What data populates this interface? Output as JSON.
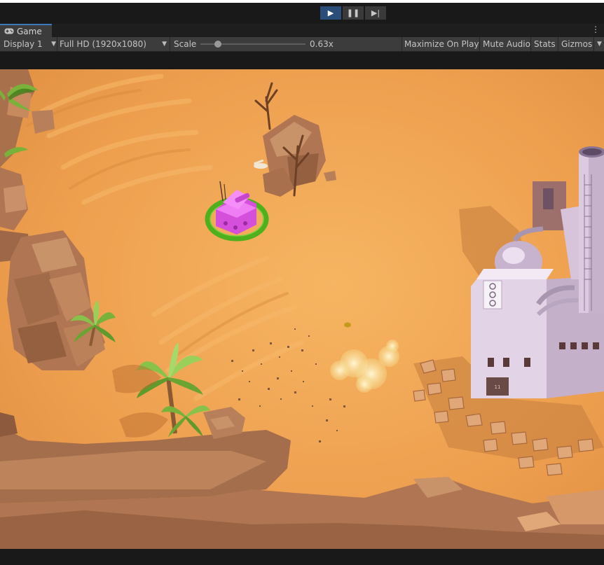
{
  "playbar": {
    "play_icon": "play-icon",
    "pause_icon": "pause-icon",
    "step_icon": "step-icon",
    "active_color": "#2a4d7a"
  },
  "tab": {
    "label": "Game",
    "icon": "gamepad-icon",
    "menu_glyph": "⋮"
  },
  "toolbar": {
    "display": "Display 1",
    "resolution": "Full HD (1920x1080)",
    "scale_label": "Scale",
    "scale_value": "0.63x",
    "maximize_on_play": "Maximize On Play",
    "mute_audio": "Mute Audio",
    "stats": "Stats",
    "gizmos": "Gizmos"
  },
  "scene": {
    "factory_door_number": "11",
    "colors": {
      "sand": "#eea04f",
      "rock": "#b07552",
      "player_tank": "#e25ee8",
      "selection_ring": "#4fb01e",
      "factory": "#d9c6dd"
    }
  }
}
